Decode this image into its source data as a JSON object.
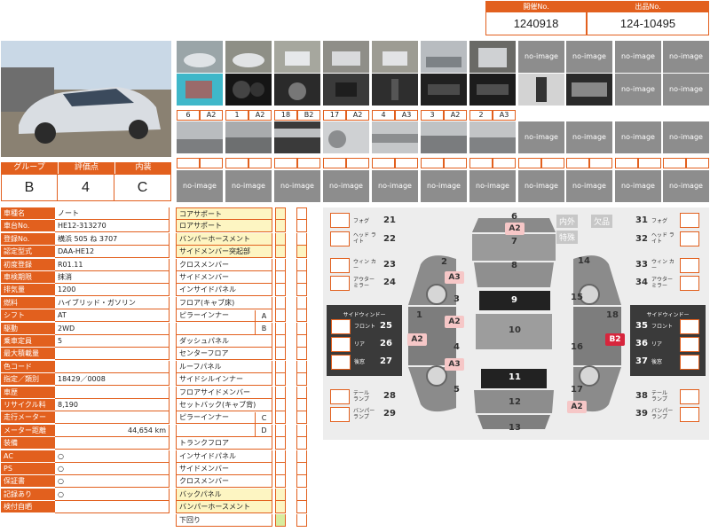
{
  "header": {
    "auction_no_label": "開催No.",
    "auction_no": "1240918",
    "lot_no_label": "出品No.",
    "lot_no": "124-10495"
  },
  "photos": {
    "noimage_text": "no-image",
    "tags": [
      [
        "6",
        "A2"
      ],
      [
        "1",
        "A2"
      ],
      [
        "18",
        "B2"
      ],
      [
        "17",
        "A2"
      ],
      [
        "4",
        "A3"
      ],
      [
        "3",
        "A2"
      ],
      [
        "2",
        "A3"
      ]
    ]
  },
  "grade": {
    "group_label": "グループ",
    "group_value": "B",
    "score_label": "評価点",
    "score_value": "4",
    "interior_label": "内装",
    "interior_value": "C"
  },
  "specs": [
    {
      "k": "車種名",
      "v": "ノート"
    },
    {
      "k": "車台No.",
      "v": "HE12-313270"
    },
    {
      "k": "登録No.",
      "v": "横浜 505 ね 3707"
    },
    {
      "k": "認定型式",
      "v": "DAA-HE12"
    },
    {
      "k": "初度登録",
      "v": "R01.11"
    },
    {
      "k": "車検期限",
      "v": "抹消"
    },
    {
      "k": "排気量",
      "v": "1200"
    },
    {
      "k": "燃料",
      "v": "ハイブリッド・ガソリン"
    },
    {
      "k": "シフト",
      "v": "AT"
    },
    {
      "k": "駆動",
      "v": "2WD"
    },
    {
      "k": "乗車定員",
      "v": "5"
    },
    {
      "k": "最大積載量",
      "v": ""
    },
    {
      "k": "色コード",
      "v": ""
    },
    {
      "k": "指定／類別",
      "v": "18429／0008"
    },
    {
      "k": "車歴",
      "v": ""
    },
    {
      "k": "リサイクル料",
      "v": "8,190"
    },
    {
      "k": "走行メーター",
      "v": ""
    },
    {
      "k": "メーター距離",
      "v": "44,654 km"
    },
    {
      "k": "装備",
      "v": ""
    },
    {
      "k": "AC",
      "v": "○"
    },
    {
      "k": "PS",
      "v": "○"
    },
    {
      "k": "保証書",
      "v": "○"
    },
    {
      "k": "記録あり",
      "v": "○"
    },
    {
      "k": "検付自晒",
      "v": ""
    }
  ],
  "parts": [
    "コアサポート",
    "ロアサポート",
    "バンパーホースメント",
    "サイドメンバー突起部",
    "クロスメンバー",
    "サイドメンバー",
    "インサイドパネル",
    "フロア(キャブ床)",
    "ピラーインナー",
    "",
    "ダッシュパネル",
    "センターフロア",
    "ルーフパネル",
    "サイドシルインナー",
    "フロアサイドメンバー",
    "セットバック(キャブ背)",
    "ピラーインナー",
    "",
    "トランクフロア",
    "インサイドパネル",
    "サイドメンバー",
    "クロスメンバー",
    "バックパネル",
    "バンパーホースメント",
    "下回り"
  ],
  "pillar_tags": [
    "A",
    "B",
    "C",
    "D"
  ],
  "diagram": {
    "legend_inner": "内外",
    "legend_missing": "欠品",
    "legend_special": "特殊",
    "left_items": [
      {
        "label": "フォグ",
        "num": "21"
      },
      {
        "label": "ヘッド ライト",
        "num": "22"
      },
      {
        "label": "ウィン カー",
        "num": "23"
      },
      {
        "label": "アウター ミラー",
        "num": "24"
      },
      {
        "label": "テール ランプ",
        "num": "28"
      },
      {
        "label": "バンパー ランプ",
        "num": "29"
      }
    ],
    "right_items": [
      {
        "label": "フォグ",
        "num": "31"
      },
      {
        "label": "ヘッド ライト",
        "num": "32"
      },
      {
        "label": "ウィン カー",
        "num": "33"
      },
      {
        "label": "アウター ミラー",
        "num": "34"
      },
      {
        "label": "テール ランプ",
        "num": "38"
      },
      {
        "label": "バンパー ランプ",
        "num": "39"
      }
    ],
    "side_window_title": "サイドウィンドー",
    "left_window": [
      {
        "label": "フロント",
        "num": "25"
      },
      {
        "label": "リア",
        "num": "26"
      },
      {
        "label": "後窓",
        "num": "27"
      }
    ],
    "right_window": [
      {
        "label": "フロント",
        "num": "35"
      },
      {
        "label": "リア",
        "num": "36"
      },
      {
        "label": "後窓",
        "num": "37"
      }
    ],
    "panel_numbers": [
      "6",
      "8",
      "9",
      "10",
      "11",
      "12",
      "13",
      "2",
      "1",
      "3",
      "4",
      "5",
      "14",
      "15",
      "16",
      "17",
      "18",
      "7"
    ],
    "damage": [
      "A2",
      "A3",
      "A2",
      "A2",
      "A3",
      "A2",
      "B2"
    ]
  },
  "colors": {
    "accent": "#e2601e",
    "yellow": "#fdf5c2",
    "green": "#d8ec9e",
    "noimage": "#8d8d8d"
  }
}
